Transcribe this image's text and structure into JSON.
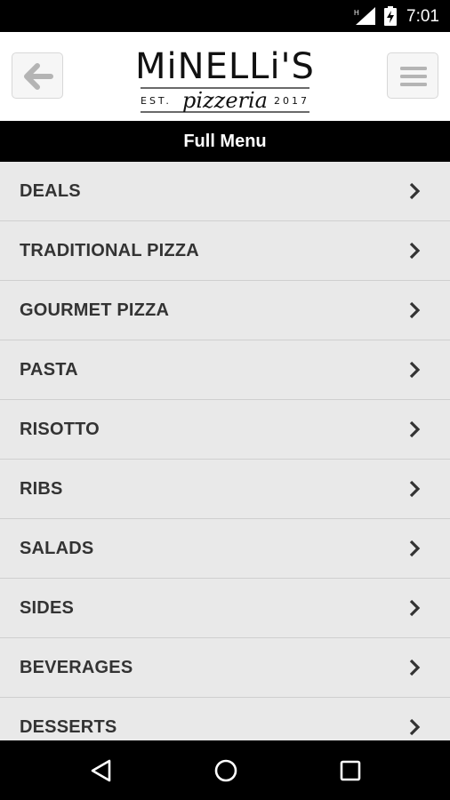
{
  "status_bar": {
    "time": "7:01",
    "icons": [
      "signal-icon",
      "battery-charging-icon"
    ]
  },
  "header": {
    "back_icon": "arrow-left-icon",
    "menu_icon": "hamburger-icon",
    "logo": {
      "name": "MiNELLi'S",
      "left_tag": "EST.",
      "script": "pizzeria",
      "year": "2017"
    }
  },
  "page_title": "Full Menu",
  "menu": {
    "items": [
      {
        "label": "DEALS"
      },
      {
        "label": "TRADITIONAL PIZZA"
      },
      {
        "label": "GOURMET PIZZA"
      },
      {
        "label": "PASTA"
      },
      {
        "label": "RISOTTO"
      },
      {
        "label": "RIBS"
      },
      {
        "label": "SALADS"
      },
      {
        "label": "SIDES"
      },
      {
        "label": "BEVERAGES"
      },
      {
        "label": "DESSERTS"
      }
    ],
    "chevron_icon": "chevron-right-icon"
  },
  "nav_bar": {
    "icons": [
      "back-triangle-icon",
      "home-circle-icon",
      "recents-square-icon"
    ]
  },
  "colors": {
    "bar_black": "#000000",
    "menu_bg": "#e9e9e9",
    "menu_text": "#333333",
    "divider": "#cfcfcf",
    "header_bg": "#ffffff",
    "button_bg": "#f6f6f6"
  }
}
